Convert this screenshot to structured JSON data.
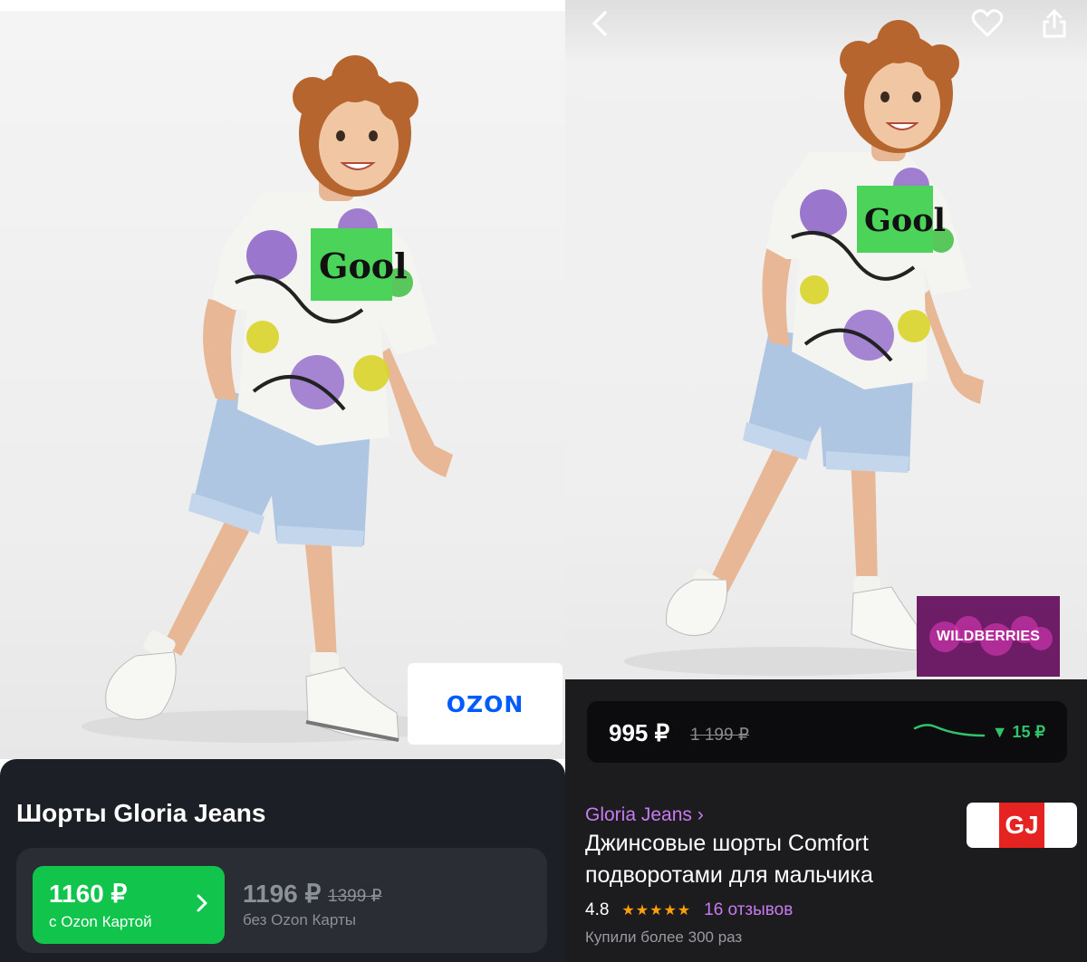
{
  "left_panel": {
    "marketplace_logo": "OZON",
    "product_title": "Шорты Gloria Jeans",
    "card_price": "1160 ₽",
    "card_label": "с Ozon Картой",
    "regular_price": "1196 ₽",
    "old_price": "1399 ₽",
    "regular_label": "без Ozon Карты",
    "chevron_icon": "chevron-right-icon",
    "accent_color": "#10c44c",
    "logo_color": "#005bff"
  },
  "right_panel": {
    "topbar_icons": [
      "back-arrow-icon",
      "heart-icon",
      "share-icon"
    ],
    "marketplace_logo": "WILDBERRIES",
    "price": "995 ₽",
    "old_price": "1 199 ₽",
    "price_drop": "▼ 15 ₽",
    "brand_link": "Gloria Jeans ›",
    "product_title": "Джинсовые шорты Comfort подворотами для мальчика",
    "rating": "4.8",
    "stars": "★★★★★",
    "reviews": "16 отзывов",
    "bought": "Купили более 300 раз",
    "brand_logo": "GJ",
    "accent_color": "#c67cf0",
    "trend_color": "#2fc46b",
    "star_color": "#ff9f0a"
  }
}
